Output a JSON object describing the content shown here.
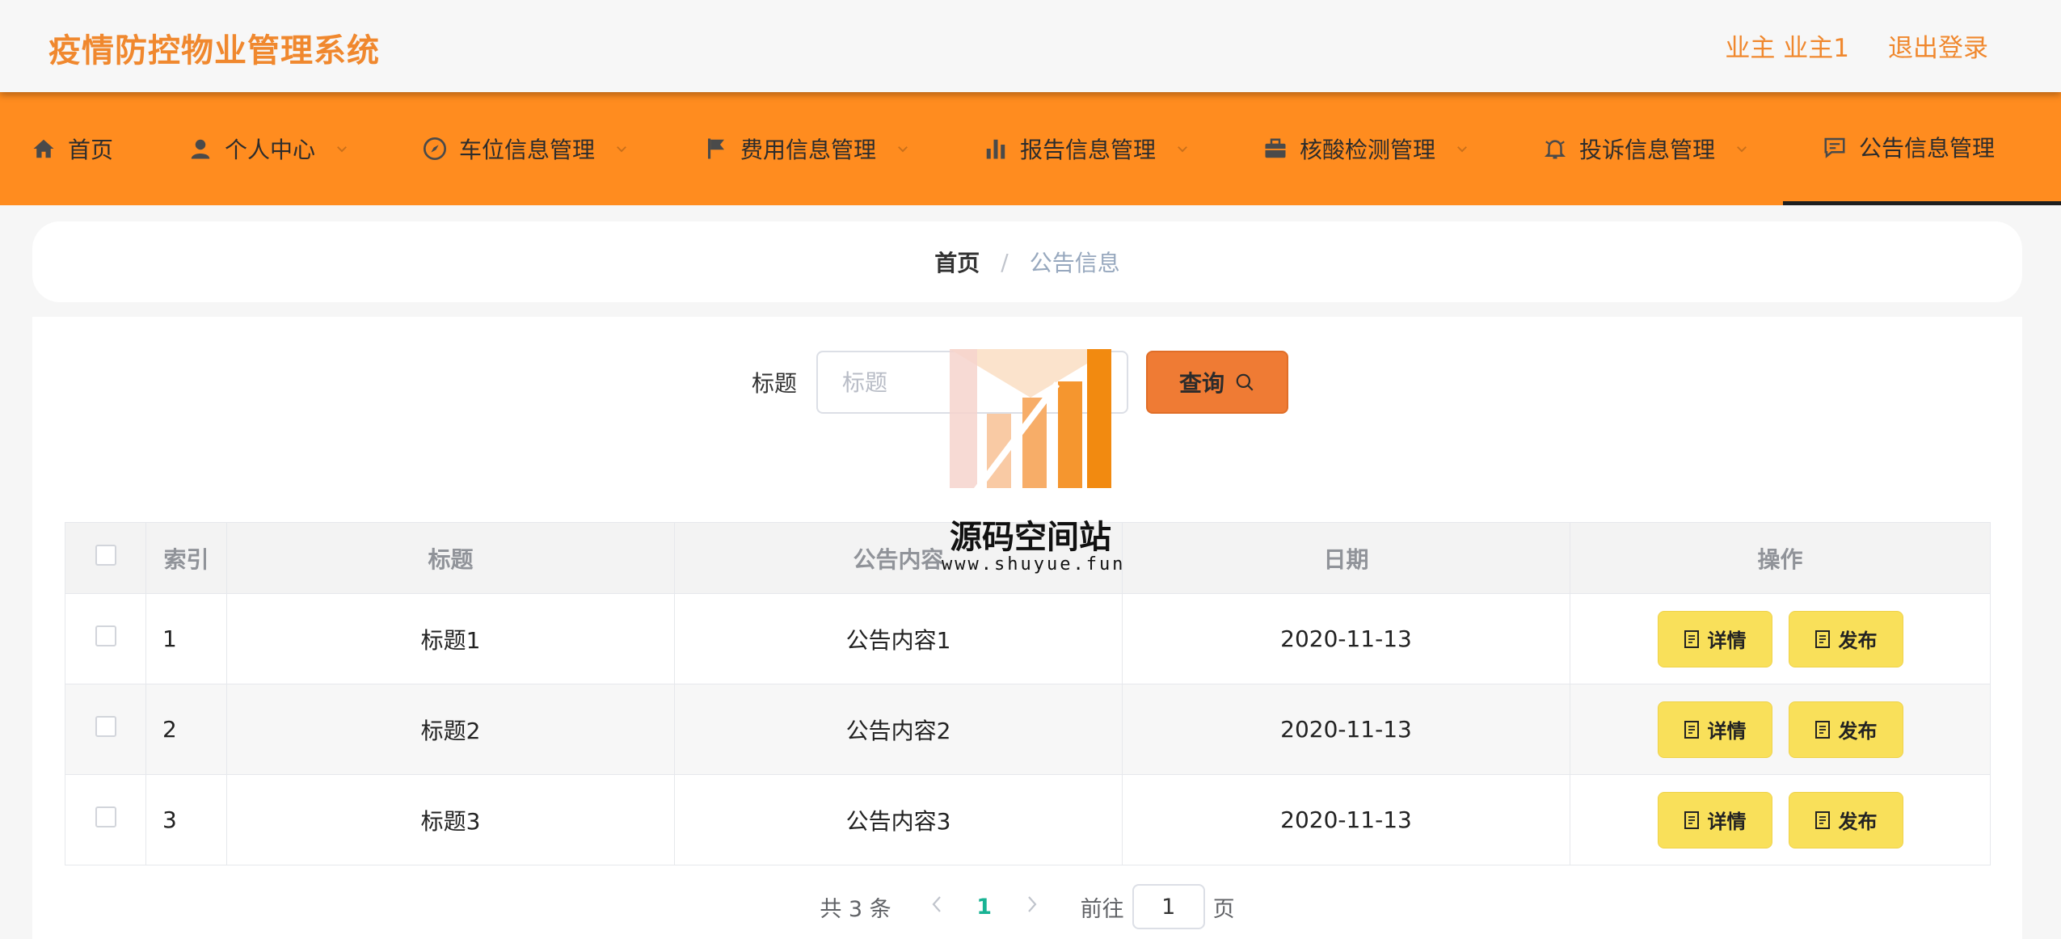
{
  "header": {
    "title": "疫情防控物业管理系统",
    "user_label": "业主 业主1",
    "logout_label": "退出登录"
  },
  "nav": {
    "items": [
      {
        "label": "首页",
        "icon": "home-icon"
      },
      {
        "label": "个人中心",
        "icon": "user-icon"
      },
      {
        "label": "车位信息管理",
        "icon": "compass-icon"
      },
      {
        "label": "费用信息管理",
        "icon": "flag-icon"
      },
      {
        "label": "报告信息管理",
        "icon": "bar-chart-icon"
      },
      {
        "label": "核酸检测管理",
        "icon": "briefcase-icon"
      },
      {
        "label": "投诉信息管理",
        "icon": "bell-icon"
      },
      {
        "label": "公告信息管理",
        "icon": "message-icon"
      }
    ],
    "active": "公告信息管理"
  },
  "breadcrumb": {
    "home": "首页",
    "separator": "/",
    "current": "公告信息"
  },
  "search": {
    "label": "标题",
    "placeholder": "标题",
    "value": "",
    "button_label": "查询"
  },
  "table": {
    "columns": [
      "",
      "索引",
      "标题",
      "公告内容",
      "日期",
      "操作"
    ],
    "rows": [
      {
        "index": "1",
        "title": "标题1",
        "content": "公告内容1",
        "date": "2020-11-13"
      },
      {
        "index": "2",
        "title": "标题2",
        "content": "公告内容2",
        "date": "2020-11-13"
      },
      {
        "index": "3",
        "title": "标题3",
        "content": "公告内容3",
        "date": "2020-11-13"
      }
    ],
    "detail_label": "详情",
    "publish_label": "发布"
  },
  "pagination": {
    "total_text": "共 3 条",
    "current_page": "1",
    "goto_label": "前往",
    "goto_value": "1",
    "page_unit": "页"
  },
  "watermark": {
    "name": "源码空间站",
    "url": "www.shuyue.fun"
  },
  "colors": {
    "accent": "#f0882e",
    "nav_bg": "#ff8c1f",
    "search_button": "#ef7b34",
    "action_button": "#f9e05a",
    "pager_active": "#19b394"
  }
}
